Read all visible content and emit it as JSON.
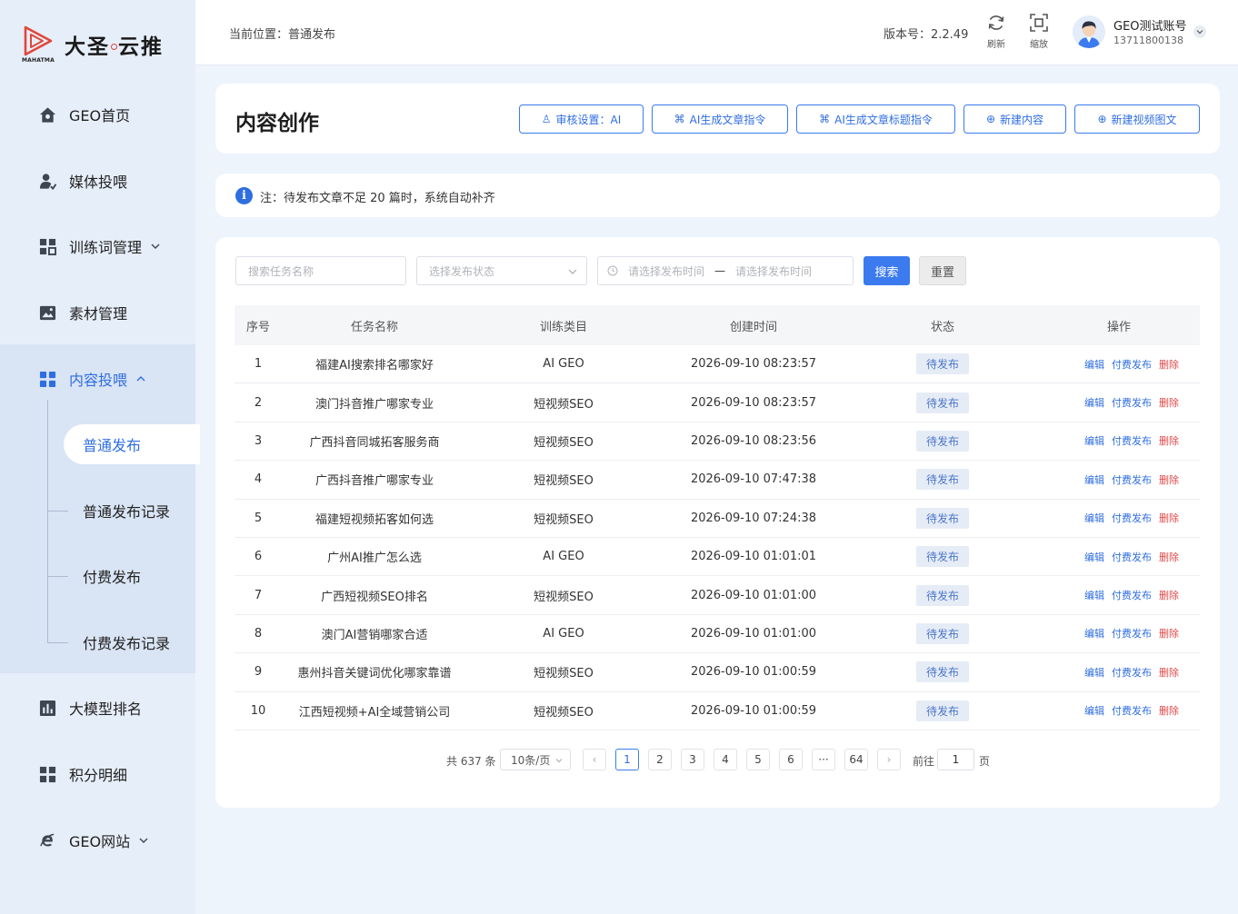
{
  "brand": {
    "name": "大圣",
    "name2": "云推",
    "sub": "MAHATMA"
  },
  "sidebar": {
    "items": [
      {
        "label": "GEO首页",
        "icon": "home-icon"
      },
      {
        "label": "媒体投喂",
        "icon": "user-icon"
      },
      {
        "label": "训练词管理",
        "icon": "grid-icon"
      },
      {
        "label": "素材管理",
        "icon": "image-icon"
      },
      {
        "label": "内容投喂",
        "icon": "grid-icon"
      },
      {
        "label": "大模型排名",
        "icon": "bar-chart-icon"
      },
      {
        "label": "积分明细",
        "icon": "grid-icon"
      },
      {
        "label": "GEO网站",
        "icon": "ie-icon"
      }
    ],
    "subitems": [
      {
        "label": "普通发布"
      },
      {
        "label": "普通发布记录"
      },
      {
        "label": "付费发布"
      },
      {
        "label": "付费发布记录"
      }
    ]
  },
  "header": {
    "breadcrumb": "当前位置：普通发布",
    "version": "版本号：2.2.49",
    "refresh_label": "刷新",
    "zoom_label": "缩放",
    "user_name": "GEO测试账号",
    "user_phone": "13711800138"
  },
  "page": {
    "title": "内容创作",
    "buttons": {
      "review": "审核设置：AI",
      "ai_article": "AI生成文章指令",
      "ai_title": "AI生成文章标题指令",
      "new_content": "新建内容",
      "new_video": "新建视频图文"
    },
    "notice": "注：待发布文章不足 20 篇时，系统自动补齐"
  },
  "filters": {
    "task_placeholder": "搜索任务名称",
    "status_placeholder": "选择发布状态",
    "start_placeholder": "请选择发布时间",
    "range_sep": "—",
    "end_placeholder": "请选择发布时间",
    "search_label": "搜索",
    "reset_label": "重置"
  },
  "table": {
    "headers": [
      "序号",
      "任务名称",
      "训练类目",
      "创建时间",
      "状态",
      "操作"
    ],
    "ops": {
      "edit": "编辑",
      "paid": "付费发布",
      "delete": "删除"
    },
    "rows": [
      {
        "no": "1",
        "name": "福建AI搜索排名哪家好",
        "category": "AI GEO",
        "created": "2026-09-10 08:23:57",
        "status": "待发布"
      },
      {
        "no": "2",
        "name": "澳门抖音推广哪家专业",
        "category": "短视频SEO",
        "created": "2026-09-10 08:23:57",
        "status": "待发布"
      },
      {
        "no": "3",
        "name": "广西抖音同城拓客服务商",
        "category": "短视频SEO",
        "created": "2026-09-10 08:23:56",
        "status": "待发布"
      },
      {
        "no": "4",
        "name": "广西抖音推广哪家专业",
        "category": "短视频SEO",
        "created": "2026-09-10 07:47:38",
        "status": "待发布"
      },
      {
        "no": "5",
        "name": "福建短视频拓客如何选",
        "category": "短视频SEO",
        "created": "2026-09-10 07:24:38",
        "status": "待发布"
      },
      {
        "no": "6",
        "name": "广州AI推广怎么选",
        "category": "AI GEO",
        "created": "2026-09-10 01:01:01",
        "status": "待发布"
      },
      {
        "no": "7",
        "name": "广西短视频SEO排名",
        "category": "短视频SEO",
        "created": "2026-09-10 01:01:00",
        "status": "待发布"
      },
      {
        "no": "8",
        "name": "澳门AI营销哪家合适",
        "category": "AI GEO",
        "created": "2026-09-10 01:01:00",
        "status": "待发布"
      },
      {
        "no": "9",
        "name": "惠州抖音关键词优化哪家靠谱",
        "category": "短视频SEO",
        "created": "2026-09-10 01:00:59",
        "status": "待发布"
      },
      {
        "no": "10",
        "name": "江西短视频+AI全域营销公司",
        "category": "短视频SEO",
        "created": "2026-09-10 01:00:59",
        "status": "待发布"
      }
    ]
  },
  "pagination": {
    "total": "共 637 条",
    "page_size": "10条/页",
    "pages": [
      "1",
      "2",
      "3",
      "4",
      "5",
      "6",
      "···",
      "64"
    ],
    "current": "1",
    "goto_label": "前往",
    "goto_value": "1",
    "goto_suffix": "页"
  },
  "colors": {
    "accent": "#3b7bef",
    "danger": "#e04848",
    "sidebar_bg": "#e6eef9",
    "page_bg": "#eef4fc"
  }
}
